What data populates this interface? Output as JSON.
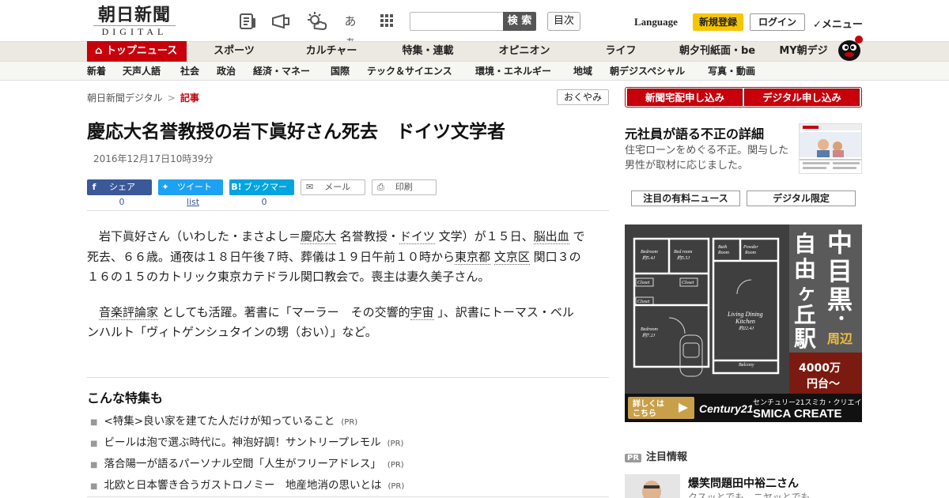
{
  "header": {
    "logo_line1": "朝日新聞",
    "logo_line2": "DIGITAL",
    "icons": [
      "newspaper-icon",
      "megaphone-icon",
      "weather-icon",
      "font-size-icon",
      "grid-icon"
    ],
    "font_size_label": "あぁ",
    "search_placeholder": "",
    "search_button": "検 索",
    "toc_button": "目次",
    "language": "Language",
    "signup": "新規登録",
    "login": "ログイン",
    "menu": "✓メニュー"
  },
  "nav1": {
    "active": "トップニュース",
    "items": [
      "スポーツ",
      "カルチャー",
      "特集・連載",
      "オピニオン",
      "ライフ",
      "朝夕刊紙面・be",
      "MY朝デジ"
    ]
  },
  "nav2": {
    "items": [
      "新着",
      "天声人語",
      "社会",
      "政治",
      "経済・マネー",
      "国際",
      "テック＆サイエンス",
      "環境・エネルギー",
      "地域",
      "朝デジスペシャル",
      "写真・動画"
    ]
  },
  "breadcrumb": {
    "root": "朝日新聞デジタル",
    "sep": ">",
    "current": "記事"
  },
  "okuyami": "おくやみ",
  "article": {
    "headline": "慶応大名誉教授の岩下眞好さん死去　ドイツ文学者",
    "date": "2016年12月17日10時39分",
    "share": {
      "facebook_label": "シェア",
      "facebook_count": "0",
      "twitter_label": "ツイート",
      "twitter_count": "list",
      "hatena_icon": "B!",
      "hatena_label": "ブックマーク",
      "hatena_count": "0",
      "mail_label": "メール",
      "print_label": "印刷"
    },
    "p1": {
      "t1": "　岩下眞好さん（いわした・まさよし＝",
      "k1": "慶応大",
      "t2": "名誉教授・",
      "k2": "ドイツ",
      "t3": "文学）が１５日、",
      "k3": "脳出血",
      "t4": "で死去、６６歳。通夜は１８日午後７時、葬儀は１９日午前１０時から",
      "k4": "東京都",
      "k5": "文京区",
      "t5": "関口３の１６の１５のカトリック東京カテドラル関口教会で。喪主は妻久美子さん。"
    },
    "p2": {
      "t1": "　",
      "k1": "音楽評論家",
      "t2": "としても活躍。著書に「マーラー　その交響的",
      "k2": "宇宙",
      "t3": "」、訳書にトーマス・ベルンハルト「ヴィトゲンシュタインの甥（おい）」など。"
    }
  },
  "tokushu": {
    "title": "こんな特集も",
    "pr_tag": "(PR)",
    "items": [
      "<特集>良い家を建てた人だけが知っていること",
      "ビールは泡で選ぶ時代に。神泡好調！サントリープレモル",
      "落合陽一が語るパーソナル空間「人生がフリーアドレス」",
      "北欧と日本響き合うガストロノミー　地産地消の思いとは"
    ]
  },
  "sidebar": {
    "btn_newspaper": "新聞宅配申し込み",
    "btn_digital": "デジタル申し込み",
    "promo_title": "元社員が語る不正の詳細",
    "promo_desc": "住宅ローンをめぐる不正。関与した男性が取材に応じました。",
    "tab_paid": "注目の有料ニュース",
    "tab_digital": "デジタル限定",
    "ad": {
      "rooms": [
        "Bedroom",
        "Bed room",
        "Bath Room",
        "Powder Room",
        "Closet",
        "Closet",
        "Closet",
        "Bedroom",
        "Living Dining Kitchen",
        "Balcony"
      ],
      "sizes": [
        "約5.4J",
        "約5.5J",
        "約7.2J",
        "約22.4J"
      ],
      "vertical_big": "中目黒・",
      "vertical_small": "周辺",
      "vertical_left": "自由ヶ丘駅",
      "price": "4000万円台～",
      "cta": "詳しくはこちら",
      "brand": "Century21",
      "company_jp": "センチュリー21スミカ・クリエイト",
      "company_en": "SMICA CREATE"
    },
    "attn_pr": "PR",
    "attn_label": "注目情報",
    "attn_title": "爆笑問題田中裕二さん",
    "attn_sub": "クスッとでも、ニヤッとでも"
  },
  "colors": {
    "asahi_red": "#c7000b",
    "signup_yellow": "#f7c600",
    "facebook": "#3b5998",
    "twitter": "#1da1f2",
    "hatena": "#00a4de"
  }
}
